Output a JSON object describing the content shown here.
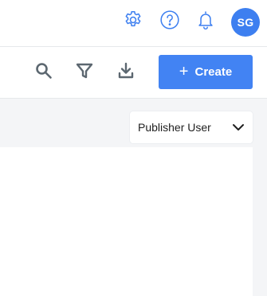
{
  "header": {
    "icons": [
      "gear-icon",
      "help-icon",
      "bell-icon"
    ],
    "avatar_initials": "SG"
  },
  "toolbar": {
    "icons": [
      "search-icon",
      "filter-icon",
      "download-icon"
    ],
    "create_label": "Create",
    "create_icon": "plus-icon"
  },
  "view_selector": {
    "selected": "Publisher User",
    "icon": "chevron-down-icon"
  },
  "colors": {
    "accent": "#4283f3",
    "header_icon": "#3d7ff0",
    "toolbar_icon": "#5c6770",
    "background": "#f4f5f7"
  }
}
